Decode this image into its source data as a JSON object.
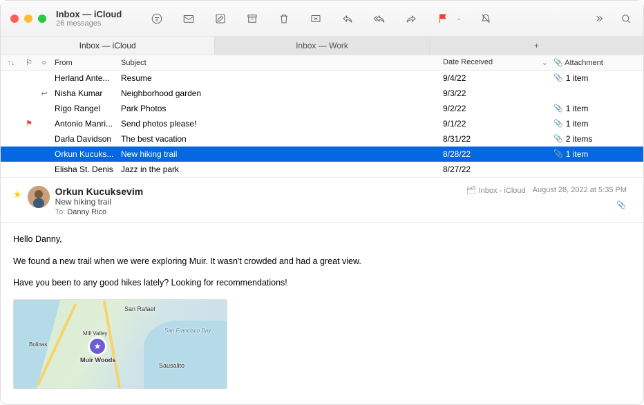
{
  "window": {
    "title": "Inbox — iCloud",
    "subtitle": "26 messages"
  },
  "tabs": {
    "active": "Inbox — iCloud",
    "inactive": "Inbox — Work"
  },
  "columns": {
    "from": "From",
    "subject": "Subject",
    "date": "Date Received",
    "attachment": "Attachment"
  },
  "messages": [
    {
      "from": "Herland Ante...",
      "subject": "Resume",
      "date": "9/4/22",
      "attachment": "1 item",
      "flag": "",
      "replied": ""
    },
    {
      "from": "Nisha Kumar",
      "subject": "Neighborhood garden",
      "date": "9/3/22",
      "attachment": "",
      "flag": "",
      "replied": "↩"
    },
    {
      "from": "Rigo Rangel",
      "subject": "Park Photos",
      "date": "9/2/22",
      "attachment": "1 item",
      "flag": "",
      "replied": ""
    },
    {
      "from": "Antonio Manri...",
      "subject": "Send photos please!",
      "date": "9/1/22",
      "attachment": "1 item",
      "flag": "⚑",
      "replied": ""
    },
    {
      "from": "Darla Davidson",
      "subject": "The best vacation",
      "date": "8/31/22",
      "attachment": "2 items",
      "flag": "",
      "replied": ""
    },
    {
      "from": "Orkun Kucuks...",
      "subject": "New hiking trail",
      "date": "8/28/22",
      "attachment": "1 item",
      "flag": "",
      "replied": "",
      "selected": true
    },
    {
      "from": "Elisha St. Denis",
      "subject": "Jazz in the park",
      "date": "8/27/22",
      "attachment": "",
      "flag": "",
      "replied": ""
    }
  ],
  "preview": {
    "sender": "Orkun Kucuksevim",
    "subject": "New hiking trail",
    "to_label": "To:",
    "recipient": "Danny Rico",
    "folder": "Inbox - iCloud",
    "date": "August 28, 2022 at 5:35 PM",
    "body": {
      "p1": "Hello Danny,",
      "p2": "We found a new trail when we were exploring Muir. It wasn't crowded and had a great view.",
      "p3": "Have you been to any good hikes lately? Looking for recommendations!"
    },
    "map": {
      "pin_label": "Muir Woods",
      "places": {
        "a": "San Rafael",
        "b": "Sausalito",
        "c": "Mill Valley",
        "d": "Bolinas",
        "e": "San Francisco Bay"
      }
    }
  }
}
